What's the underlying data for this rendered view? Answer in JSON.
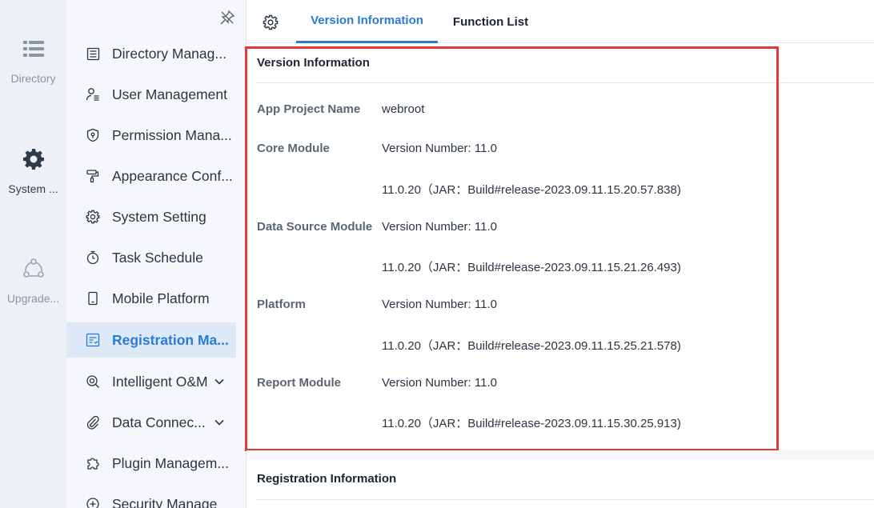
{
  "rail": {
    "items": [
      {
        "label": "Directory",
        "icon": "list-icon"
      },
      {
        "label": "System ...",
        "icon": "gear-icon"
      },
      {
        "label": "Upgrade...",
        "icon": "nodes-icon"
      }
    ]
  },
  "sidebar": {
    "items": [
      {
        "label": "Directory Manag...",
        "icon": "directory-icon"
      },
      {
        "label": "User Management",
        "icon": "user-list-icon"
      },
      {
        "label": "Permission Mana...",
        "icon": "shield-icon"
      },
      {
        "label": "Appearance Conf...",
        "icon": "paint-roller-icon"
      },
      {
        "label": "System Setting",
        "icon": "gear-icon"
      },
      {
        "label": "Task Schedule",
        "icon": "stopwatch-icon"
      },
      {
        "label": "Mobile Platform",
        "icon": "mobile-icon"
      },
      {
        "label": "Registration Ma...",
        "icon": "registration-icon",
        "active": true
      },
      {
        "label": "Intelligent O&M",
        "icon": "om-icon",
        "expandable": true
      },
      {
        "label": "Data Connec...",
        "icon": "paperclip-icon",
        "expandable": true
      },
      {
        "label": "Plugin Managem...",
        "icon": "puzzle-icon"
      },
      {
        "label": "Security Manage",
        "icon": "security-icon"
      }
    ]
  },
  "tabs": [
    {
      "label": "Version Information",
      "active": true
    },
    {
      "label": "Function List",
      "active": false
    }
  ],
  "version_info": {
    "title": "Version Information",
    "rows": [
      {
        "label": "App Project Name",
        "value": "webroot"
      },
      {
        "label": "Core Module",
        "value": "Version Number: 11.0"
      },
      {
        "label": "",
        "value": "11.0.20（JAR：Build#release-2023.09.11.15.20.57.838)"
      },
      {
        "label": "Data Source Module",
        "value": "Version Number: 11.0"
      },
      {
        "label": "",
        "value": "11.0.20（JAR：Build#release-2023.09.11.15.21.26.493)"
      },
      {
        "label": "Platform",
        "value": "Version Number: 11.0"
      },
      {
        "label": "",
        "value": "11.0.20（JAR：Build#release-2023.09.11.15.25.21.578)"
      },
      {
        "label": "Report Module",
        "value": "Version Number: 11.0"
      },
      {
        "label": "",
        "value": "11.0.20（JAR：Build#release-2023.09.11.15.30.25.913)"
      }
    ]
  },
  "registration_info": {
    "title": "Registration Information"
  },
  "colors": {
    "accent": "#2a7bd6",
    "highlight_border": "#e53935",
    "rail_bg": "#edf1f6",
    "sidebar_bg": "#f5f7fa",
    "active_item_bg": "#dde9f7"
  }
}
